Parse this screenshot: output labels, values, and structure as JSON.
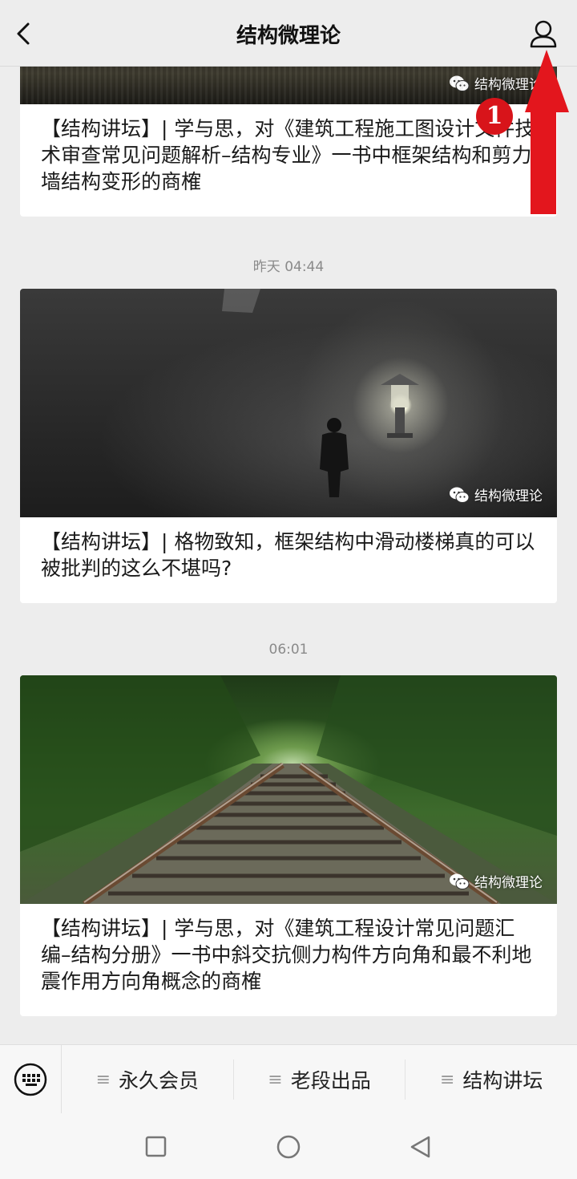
{
  "header": {
    "title": "结构微理论"
  },
  "feed": {
    "articles": [
      {
        "title": "【结构讲坛】| 学与思，对《建筑工程施工图设计文件技术审查常见问题解析–结构专业》一书中框架结构和剪力墙结构变形的商榷",
        "watermark": "结构微理论"
      },
      {
        "timestamp": "昨天 04:44",
        "title": "【结构讲坛】| 格物致知，框架结构中滑动楼梯真的可以被批判的这么不堪吗?",
        "watermark": "结构微理论"
      },
      {
        "timestamp": "06:01",
        "title": "【结构讲坛】| 学与思，对《建筑工程设计常见问题汇编–结构分册》一书中斜交抗侧力构件方向角和最不利地震作用方向角概念的商榷",
        "watermark": "结构微理论"
      }
    ]
  },
  "annotation": {
    "badge": "1",
    "color": "#d8141a"
  },
  "menu": {
    "items": [
      {
        "label": "永久会员"
      },
      {
        "label": "老段出品"
      },
      {
        "label": "结构讲坛"
      }
    ]
  }
}
